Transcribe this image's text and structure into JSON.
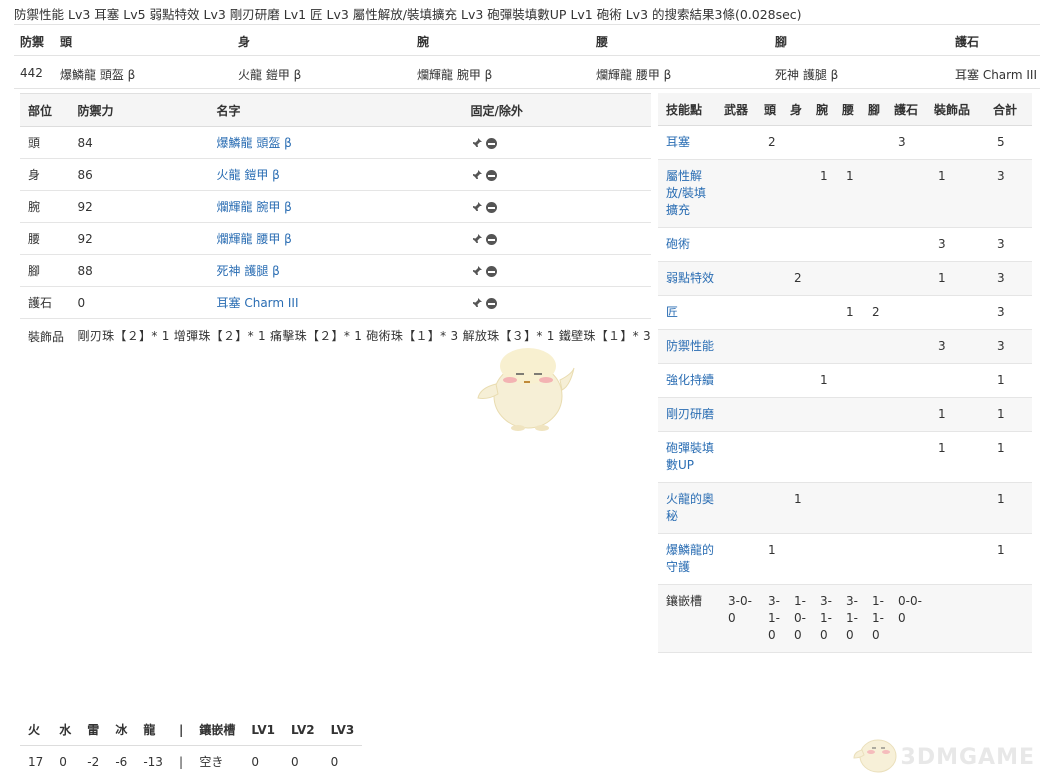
{
  "summary": "防禦性能 Lv3 耳塞 Lv5 弱點特效 Lv3 剛刃研磨 Lv1 匠 Lv3 屬性解放/裝填擴充 Lv3 砲彈裝填數UP Lv1 砲術 Lv3 的搜索結果3條(0.028sec)",
  "top": {
    "headers": [
      "防禦",
      "頭",
      "身",
      "腕",
      "腰",
      "腳",
      "護石"
    ],
    "values": [
      "442",
      "爆鱗龍 頭盔 β",
      "火龍 鎧甲 β",
      "爛輝龍 腕甲 β",
      "爛輝龍 腰甲 β",
      "死神 護腿 β",
      "耳塞 Charm III"
    ]
  },
  "equip": {
    "headers": [
      "部位",
      "防禦力",
      "名字",
      "固定/除外"
    ],
    "rows": [
      {
        "part": "頭",
        "def": "84",
        "name": "爆鱗龍 頭盔 β"
      },
      {
        "part": "身",
        "def": "86",
        "name": "火龍 鎧甲 β"
      },
      {
        "part": "腕",
        "def": "92",
        "name": "爛輝龍 腕甲 β"
      },
      {
        "part": "腰",
        "def": "92",
        "name": "爛輝龍 腰甲 β"
      },
      {
        "part": "腳",
        "def": "88",
        "name": "死神 護腿 β"
      },
      {
        "part": "護石",
        "def": "0",
        "name": "耳塞 Charm III"
      }
    ],
    "deco_label": "裝飾品",
    "deco_value": "剛刃珠【２】* 1 增彈珠【２】* 1 痛擊珠【２】* 1 砲術珠【１】* 3 解放珠【３】* 1 鐵壁珠【１】* 3"
  },
  "skills": {
    "headers": [
      "技能點",
      "武器",
      "頭",
      "身",
      "腕",
      "腰",
      "腳",
      "護石",
      "裝飾品",
      "合計"
    ],
    "rows": [
      {
        "name": "耳塞",
        "v": [
          "",
          "2",
          "",
          "",
          "",
          "",
          "3",
          "",
          "5"
        ]
      },
      {
        "name": "屬性解放/裝填擴充",
        "v": [
          "",
          "",
          "",
          "1",
          "1",
          "",
          "",
          "1",
          "3"
        ]
      },
      {
        "name": "砲術",
        "v": [
          "",
          "",
          "",
          "",
          "",
          "",
          "",
          "3",
          "3"
        ]
      },
      {
        "name": "弱點特效",
        "v": [
          "",
          "",
          "2",
          "",
          "",
          "",
          "",
          "1",
          "3"
        ]
      },
      {
        "name": "匠",
        "v": [
          "",
          "",
          "",
          "",
          "1",
          "2",
          "",
          "",
          "3"
        ]
      },
      {
        "name": "防禦性能",
        "v": [
          "",
          "",
          "",
          "",
          "",
          "",
          "",
          "3",
          "3"
        ]
      },
      {
        "name": "強化持續",
        "v": [
          "",
          "",
          "",
          "1",
          "",
          "",
          "",
          "",
          "1"
        ]
      },
      {
        "name": "剛刃研磨",
        "v": [
          "",
          "",
          "",
          "",
          "",
          "",
          "",
          "1",
          "1"
        ]
      },
      {
        "name": "砲彈裝填數UP",
        "v": [
          "",
          "",
          "",
          "",
          "",
          "",
          "",
          "1",
          "1"
        ]
      },
      {
        "name": "火龍的奧秘",
        "v": [
          "",
          "",
          "1",
          "",
          "",
          "",
          "",
          "",
          "1"
        ]
      },
      {
        "name": "爆鱗龍的守護",
        "v": [
          "",
          "1",
          "",
          "",
          "",
          "",
          "",
          "",
          "1"
        ]
      }
    ],
    "slots_label": "鑲嵌槽",
    "slots": [
      "3-0-0",
      "3-1-0",
      "1-0-0",
      "3-1-0",
      "3-1-0",
      "1-1-0",
      "0-0-0",
      "",
      ""
    ]
  },
  "resist": {
    "headers": [
      "火",
      "水",
      "雷",
      "冰",
      "龍",
      "|",
      "鑲嵌槽",
      "LV1",
      "LV2",
      "LV3"
    ],
    "values": [
      "17",
      "0",
      "-2",
      "-6",
      "-13",
      "|",
      "空き",
      "0",
      "0",
      "0"
    ]
  },
  "watermark": "3DMGAME"
}
